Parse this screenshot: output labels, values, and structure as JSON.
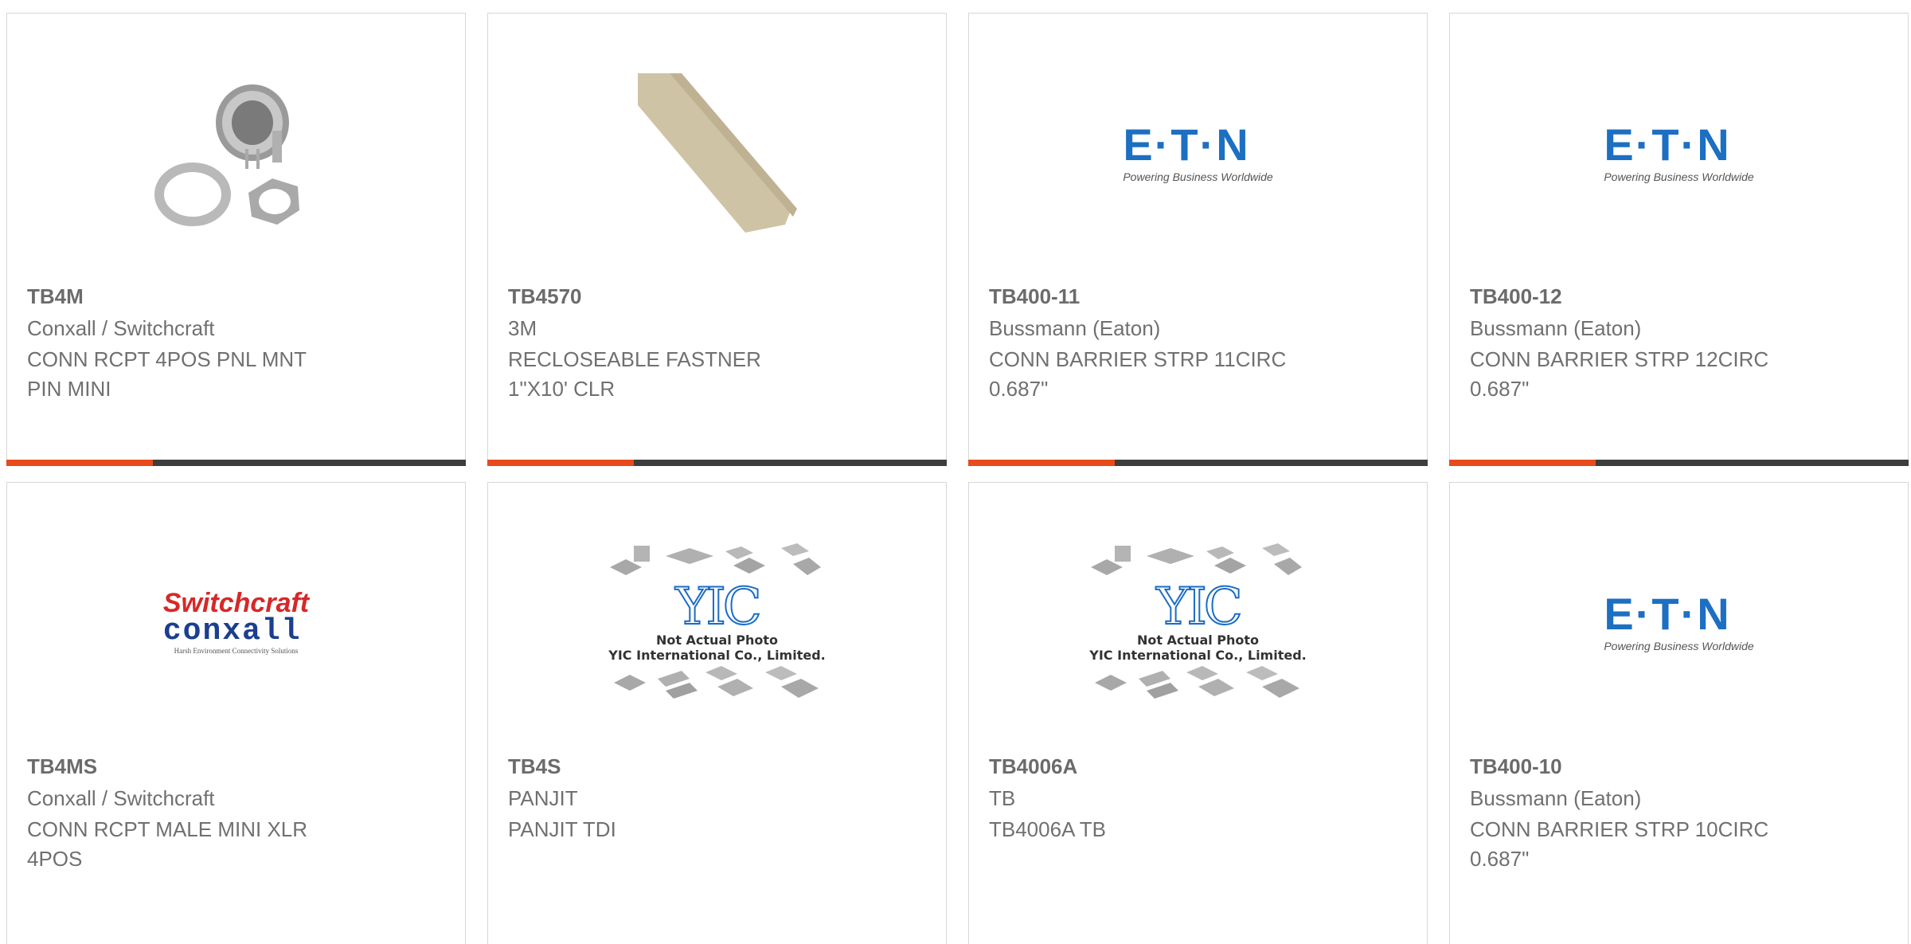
{
  "cards": [
    {
      "part": "TB4M",
      "manufacturer": "Conxall / Switchcraft",
      "desc1": "CONN RCPT 4POS PNL MNT",
      "desc2": "PIN MINI",
      "image": "connector-photo"
    },
    {
      "part": "TB4570",
      "manufacturer": "3M",
      "desc1": "RECLOSEABLE FASTNER",
      "desc2": "1\"X10' CLR",
      "image": "fastener-strip-photo"
    },
    {
      "part": "TB400-11",
      "manufacturer": "Bussmann (Eaton)",
      "desc1": "CONN BARRIER STRP 11CIRC",
      "desc2": "0.687\"",
      "image": "eaton-logo"
    },
    {
      "part": "TB400-12",
      "manufacturer": "Bussmann (Eaton)",
      "desc1": "CONN BARRIER STRP 12CIRC",
      "desc2": "0.687\"",
      "image": "eaton-logo"
    },
    {
      "part": "TB4MS",
      "manufacturer": "Conxall / Switchcraft",
      "desc1": "CONN RCPT MALE MINI XLR",
      "desc2": "4POS",
      "image": "switchcraft-logo"
    },
    {
      "part": "TB4S",
      "manufacturer": "PANJIT",
      "desc1": "PANJIT TDI",
      "desc2": "",
      "image": "yic-placeholder"
    },
    {
      "part": "TB4006A",
      "manufacturer": "TB",
      "desc1": "TB4006A TB",
      "desc2": "",
      "image": "yic-placeholder"
    },
    {
      "part": "TB400-10",
      "manufacturer": "Bussmann (Eaton)",
      "desc1": "CONN BARRIER STRP 10CIRC",
      "desc2": "0.687\"",
      "image": "eaton-logo"
    }
  ],
  "logos": {
    "eaton_name": "E·T·N",
    "eaton_tagline": "Powering Business Worldwide",
    "switchcraft_top": "Switchcraft",
    "switchcraft_mid": "conxall",
    "switchcraft_tag": "Harsh Environment Connectivity Solutions",
    "yic_mark": "YIC",
    "yic_line1": "Not Actual Photo",
    "yic_line2": "YIC International Co., Limited."
  },
  "colors": {
    "accent": "#e84a1c",
    "bar_dark": "#3d3d3d",
    "eaton_blue": "#1d6fc2",
    "switchcraft_red": "#d62828",
    "conxall_blue": "#1b3f8f"
  }
}
